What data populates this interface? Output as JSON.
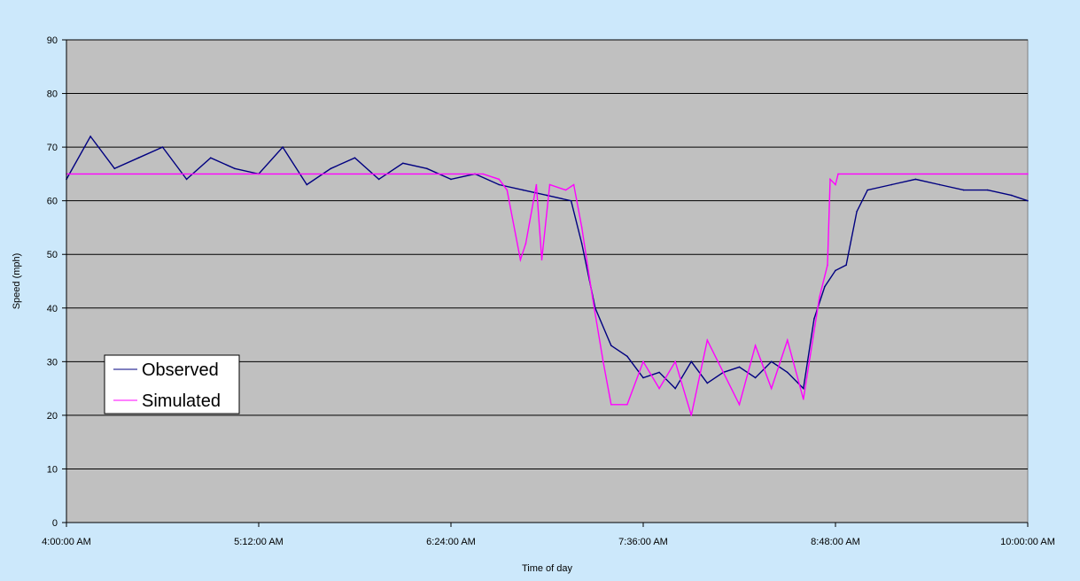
{
  "chart_data": {
    "type": "line",
    "title": "",
    "xlabel": "Time of day",
    "ylabel": "Speed (mph)",
    "ylim": [
      0,
      90
    ],
    "yticks": [
      0,
      10,
      20,
      30,
      40,
      50,
      60,
      70,
      80,
      90
    ],
    "xlim": [
      "4:00:00 AM",
      "10:00:00 AM"
    ],
    "xticks": [
      "4:00:00 AM",
      "5:12:00 AM",
      "6:24:00 AM",
      "7:36:00 AM",
      "8:48:00 AM",
      "10:00:00 AM"
    ],
    "grid": "horizontal",
    "legend_position": "left",
    "plot_background": "#c0c0c0",
    "page_background": "#cce8fb",
    "series": [
      {
        "name": "Observed",
        "color": "#000080",
        "x": [
          "4:00:00 AM",
          "4:09:00 AM",
          "4:18:00 AM",
          "4:27:00 AM",
          "4:36:00 AM",
          "4:45:00 AM",
          "4:54:00 AM",
          "5:03:00 AM",
          "5:12:00 AM",
          "5:21:00 AM",
          "5:30:00 AM",
          "5:39:00 AM",
          "5:48:00 AM",
          "5:57:00 AM",
          "6:06:00 AM",
          "6:15:00 AM",
          "6:24:00 AM",
          "6:33:00 AM",
          "6:42:00 AM",
          "6:51:00 AM",
          "7:00:00 AM",
          "7:09:00 AM",
          "7:13:00 AM",
          "7:18:00 AM",
          "7:24:00 AM",
          "7:30:00 AM",
          "7:36:00 AM",
          "7:42:00 AM",
          "7:48:00 AM",
          "7:54:00 AM",
          "8:00:00 AM",
          "8:06:00 AM",
          "8:12:00 AM",
          "8:18:00 AM",
          "8:24:00 AM",
          "8:30:00 AM",
          "8:36:00 AM",
          "8:40:00 AM",
          "8:44:00 AM",
          "8:48:00 AM",
          "8:52:00 AM",
          "8:56:00 AM",
          "9:00:00 AM",
          "9:09:00 AM",
          "9:18:00 AM",
          "9:27:00 AM",
          "9:36:00 AM",
          "9:45:00 AM",
          "9:54:00 AM",
          "10:00:00 AM"
        ],
        "values": [
          64,
          72,
          66,
          68,
          70,
          64,
          68,
          66,
          65,
          70,
          63,
          66,
          68,
          64,
          67,
          66,
          64,
          65,
          63,
          62,
          61,
          60,
          52,
          40,
          33,
          31,
          27,
          28,
          25,
          30,
          26,
          28,
          29,
          27,
          30,
          28,
          25,
          38,
          44,
          47,
          48,
          58,
          62,
          63,
          64,
          63,
          62,
          62,
          61,
          60
        ]
      },
      {
        "name": "Simulated",
        "color": "#ff00ff",
        "x": [
          "4:00:00 AM",
          "6:36:00 AM",
          "6:42:00 AM",
          "6:45:00 AM",
          "6:50:00 AM",
          "6:52:00 AM",
          "6:56:00 AM",
          "6:58:00 AM",
          "7:01:00 AM",
          "7:07:00 AM",
          "7:10:00 AM",
          "7:13:00 AM",
          "7:17:00 AM",
          "7:21:00 AM",
          "7:24:00 AM",
          "7:30:00 AM",
          "7:36:00 AM",
          "7:42:00 AM",
          "7:48:00 AM",
          "7:54:00 AM",
          "8:00:00 AM",
          "8:06:00 AM",
          "8:12:00 AM",
          "8:18:00 AM",
          "8:24:00 AM",
          "8:30:00 AM",
          "8:36:00 AM",
          "8:42:00 AM",
          "8:45:00 AM",
          "8:46:00 AM",
          "8:48:00 AM",
          "8:49:00 AM",
          "10:00:00 AM"
        ],
        "values": [
          65,
          65,
          64,
          62,
          49,
          52,
          63,
          49,
          63,
          62,
          63,
          55,
          42,
          30,
          22,
          22,
          30,
          25,
          30,
          20,
          34,
          28,
          22,
          33,
          25,
          34,
          23,
          42,
          48,
          64,
          63,
          65,
          65
        ]
      }
    ]
  }
}
